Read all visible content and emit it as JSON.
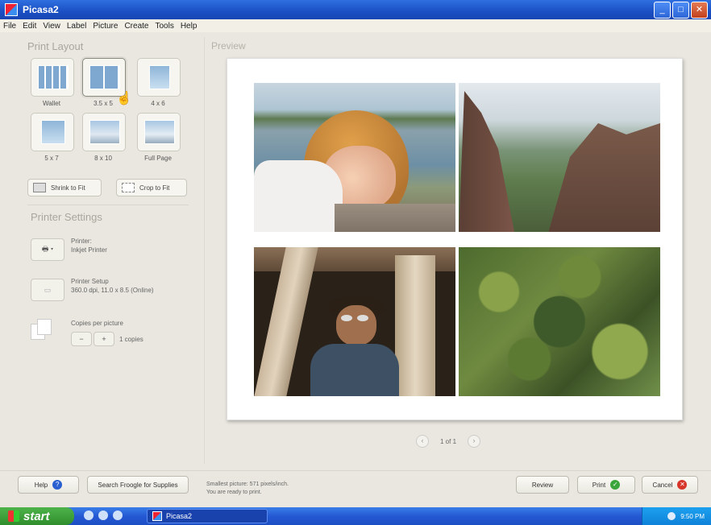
{
  "window": {
    "title": "Picasa2"
  },
  "menu": [
    "File",
    "Edit",
    "View",
    "Label",
    "Picture",
    "Create",
    "Tools",
    "Help"
  ],
  "print_layout": {
    "title": "Print Layout",
    "options": [
      "Wallet",
      "3.5 x 5",
      "4 x 6",
      "5 x 7",
      "8 x 10",
      "Full Page"
    ],
    "selected": "3.5 x 5",
    "shrink_label": "Shrink to Fit",
    "crop_label": "Crop to Fit"
  },
  "printer_settings": {
    "title": "Printer Settings",
    "printer_label": "Printer:",
    "printer_name": "Inkjet Printer",
    "setup_label": "Printer Setup",
    "setup_detail": "360.0 dpi, 11.0 x 8.5 (Online)",
    "copies_label": "Copies per picture",
    "minus": "−",
    "plus": "+",
    "copies_value": "1 copies"
  },
  "preview": {
    "title": "Preview",
    "page_indicator": "1 of 1",
    "prev": "‹",
    "next": "›"
  },
  "bottom": {
    "help_label": "Help",
    "search_label": "Search Froogle for Supplies",
    "status_line1": "Smallest picture: 571 pixels/inch.",
    "status_line2": "You are ready to print.",
    "review_label": "Review",
    "print_label": "Print",
    "cancel_label": "Cancel"
  },
  "taskbar": {
    "start_label": "start",
    "task_label": "Picasa2",
    "clock": "9:50 PM"
  },
  "colors": {
    "titlebar": "#1a4fc3",
    "taskbar": "#2459d4",
    "start_green": "#2f8e2c",
    "print_check": "#3aa53a",
    "cancel_red": "#d8352a",
    "help_blue": "#2a5fd0"
  }
}
